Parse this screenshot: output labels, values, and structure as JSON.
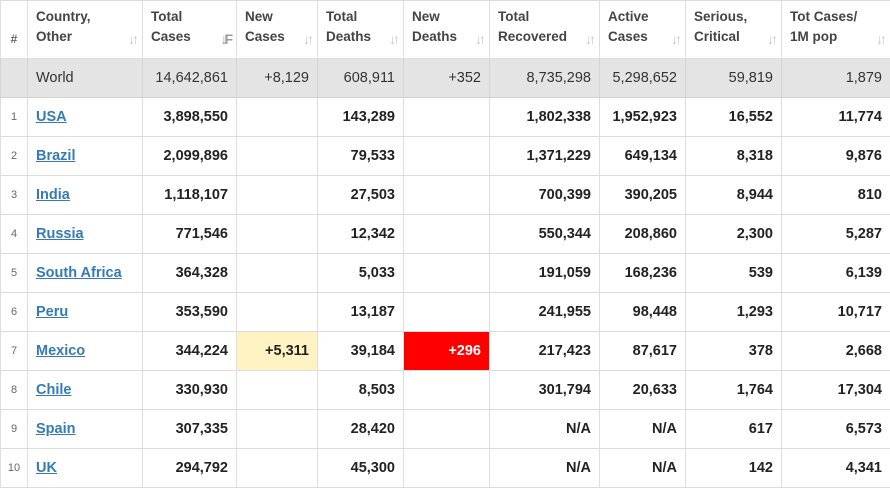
{
  "headers": [
    {
      "line1": "#",
      "line2": ""
    },
    {
      "line1": "Country,",
      "line2": "Other"
    },
    {
      "line1": "Total",
      "line2": "Cases"
    },
    {
      "line1": "New",
      "line2": "Cases"
    },
    {
      "line1": "Total",
      "line2": "Deaths"
    },
    {
      "line1": "New",
      "line2": "Deaths"
    },
    {
      "line1": "Total",
      "line2": "Recovered"
    },
    {
      "line1": "Active",
      "line2": "Cases"
    },
    {
      "line1": "Serious,",
      "line2": "Critical"
    },
    {
      "line1": "Tot Cases/",
      "line2": "1M pop"
    }
  ],
  "sort_icon": "sort-arrows-icon",
  "active_sort_icon": "sort-descending-icon",
  "world": {
    "country": "World",
    "total_cases": "14,642,861",
    "new_cases": "+8,129",
    "total_deaths": "608,911",
    "new_deaths": "+352",
    "total_recovered": "8,735,298",
    "active_cases": "5,298,652",
    "serious_critical": "59,819",
    "cases_per_1m": "1,879"
  },
  "rows": [
    {
      "idx": "1",
      "country": "USA",
      "total_cases": "3,898,550",
      "new_cases": "",
      "total_deaths": "143,289",
      "new_deaths": "",
      "total_recovered": "1,802,338",
      "active_cases": "1,952,923",
      "serious_critical": "16,552",
      "cases_per_1m": "11,774"
    },
    {
      "idx": "2",
      "country": "Brazil",
      "total_cases": "2,099,896",
      "new_cases": "",
      "total_deaths": "79,533",
      "new_deaths": "",
      "total_recovered": "1,371,229",
      "active_cases": "649,134",
      "serious_critical": "8,318",
      "cases_per_1m": "9,876"
    },
    {
      "idx": "3",
      "country": "India",
      "total_cases": "1,118,107",
      "new_cases": "",
      "total_deaths": "27,503",
      "new_deaths": "",
      "total_recovered": "700,399",
      "active_cases": "390,205",
      "serious_critical": "8,944",
      "cases_per_1m": "810"
    },
    {
      "idx": "4",
      "country": "Russia",
      "total_cases": "771,546",
      "new_cases": "",
      "total_deaths": "12,342",
      "new_deaths": "",
      "total_recovered": "550,344",
      "active_cases": "208,860",
      "serious_critical": "2,300",
      "cases_per_1m": "5,287"
    },
    {
      "idx": "5",
      "country": "South Africa",
      "total_cases": "364,328",
      "new_cases": "",
      "total_deaths": "5,033",
      "new_deaths": "",
      "total_recovered": "191,059",
      "active_cases": "168,236",
      "serious_critical": "539",
      "cases_per_1m": "6,139"
    },
    {
      "idx": "6",
      "country": "Peru",
      "total_cases": "353,590",
      "new_cases": "",
      "total_deaths": "13,187",
      "new_deaths": "",
      "total_recovered": "241,955",
      "active_cases": "98,448",
      "serious_critical": "1,293",
      "cases_per_1m": "10,717"
    },
    {
      "idx": "7",
      "country": "Mexico",
      "total_cases": "344,224",
      "new_cases": "+5,311",
      "total_deaths": "39,184",
      "new_deaths": "+296",
      "total_recovered": "217,423",
      "active_cases": "87,617",
      "serious_critical": "378",
      "cases_per_1m": "2,668"
    },
    {
      "idx": "8",
      "country": "Chile",
      "total_cases": "330,930",
      "new_cases": "",
      "total_deaths": "8,503",
      "new_deaths": "",
      "total_recovered": "301,794",
      "active_cases": "20,633",
      "serious_critical": "1,764",
      "cases_per_1m": "17,304"
    },
    {
      "idx": "9",
      "country": "Spain",
      "total_cases": "307,335",
      "new_cases": "",
      "total_deaths": "28,420",
      "new_deaths": "",
      "total_recovered": "N/A",
      "active_cases": "N/A",
      "serious_critical": "617",
      "cases_per_1m": "6,573"
    },
    {
      "idx": "10",
      "country": "UK",
      "total_cases": "294,792",
      "new_cases": "",
      "total_deaths": "45,300",
      "new_deaths": "",
      "total_recovered": "N/A",
      "active_cases": "N/A",
      "serious_critical": "142",
      "cases_per_1m": "4,341"
    }
  ],
  "colors": {
    "new_cases_highlight": "#fff3c4",
    "new_deaths_highlight": "#ff0000",
    "link": "#337ab7",
    "world_row_bg": "#e4e4e4"
  }
}
